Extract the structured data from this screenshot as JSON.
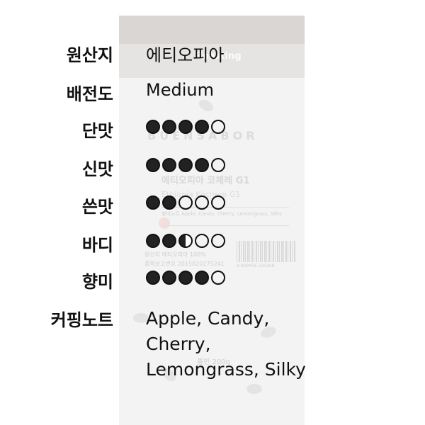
{
  "bag": {
    "banner_text": "Roasting",
    "brand": "BUENSABOR",
    "name_ko": "에티오피아 코체레 G1",
    "name_en": "Ethiopia Kochere G1",
    "notes_small": "향미노트 Apple, Candy, Cherry, Lemongrass, Silky",
    "origin_small": "원산지 에티오피아 100%",
    "report_small": "품목보고번호 2015020275241",
    "barcode_number": "8 809456 220268",
    "weight": "홀빈 200g"
  },
  "specs": {
    "origin": {
      "label": "원산지",
      "value": "에티오피아"
    },
    "roast": {
      "label": "배전도",
      "value": "Medium"
    },
    "sweetness": {
      "label": "단맛",
      "rating": 4,
      "max": 5
    },
    "acidity": {
      "label": "신맛",
      "rating": 4,
      "max": 5
    },
    "bitterness": {
      "label": "쓴맛",
      "rating": 2,
      "max": 5
    },
    "body": {
      "label": "바디",
      "rating": 2.5,
      "max": 5
    },
    "aroma": {
      "label": "향미",
      "rating": 4,
      "max": 5
    },
    "notes": {
      "label": "커핑노트",
      "lines": [
        "Apple, Candy,",
        "Cherry,",
        "Lemongrass, Silky"
      ]
    }
  }
}
